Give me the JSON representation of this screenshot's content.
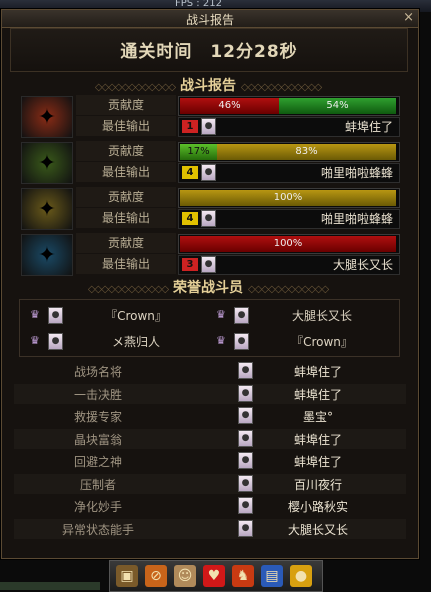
{
  "top_strip": {
    "text": "FPS : 212"
  },
  "window": {
    "title": "战斗报告",
    "close": "×"
  },
  "header": {
    "clear_time": "通关时间　12分28秒"
  },
  "sections": {
    "report": "战斗报告",
    "honor": "荣誉战斗员"
  },
  "labels": {
    "contribution": "贡献度",
    "best_output": "最佳输出"
  },
  "players": [
    {
      "bars": [
        {
          "text": "46%",
          "color": "red",
          "value": 46
        },
        {
          "text": "54%",
          "color": "green",
          "value": 54
        }
      ],
      "badge": "1",
      "badge_color": "#cc2222",
      "name": "蚌埠住了",
      "emblem_color": "#8a2c16"
    },
    {
      "bars": [
        {
          "text": "17%",
          "color": "lime",
          "value": 17
        },
        {
          "text": "83%",
          "color": "gold",
          "value": 83
        }
      ],
      "badge": "4",
      "badge_color": "#e0c000",
      "name": "啪里啪啦蜂蜂",
      "emblem_color": "#3a5a1a"
    },
    {
      "bars": [
        {
          "text": "100%",
          "color": "gold",
          "value": 100
        }
      ],
      "badge": "4",
      "badge_color": "#e0c000",
      "name": "啪里啪啦蜂蜂",
      "emblem_color": "#6a5a1a"
    },
    {
      "bars": [
        {
          "text": "100%",
          "color": "red",
          "value": 100
        }
      ],
      "badge": "3",
      "badge_color": "#cc2222",
      "name": "大腿长又长",
      "emblem_color": "#1a4a66"
    }
  ],
  "honor": [
    {
      "name": "『Crown』"
    },
    {
      "name": "大腿长又长"
    },
    {
      "name": "メ燕归人"
    },
    {
      "name": "『Crown』"
    }
  ],
  "awards": [
    {
      "title": "战场名将",
      "who": "蚌埠住了"
    },
    {
      "title": "一击决胜",
      "who": "蚌埠住了"
    },
    {
      "title": "救援专家",
      "who": "墨宝°"
    },
    {
      "title": "晶块富翁",
      "who": "蚌埠住了"
    },
    {
      "title": "回避之神",
      "who": "蚌埠住了"
    },
    {
      "title": "压制者",
      "who": "百川夜行"
    },
    {
      "title": "净化妙手",
      "who": "樱小路秋实"
    },
    {
      "title": "异常状态能手",
      "who": "大腿长又长"
    }
  ],
  "taskbar": [
    {
      "icon": "bag-icon",
      "glyph": "▣",
      "color": "#7a5a2a"
    },
    {
      "icon": "sword-icon",
      "glyph": "⊘",
      "color": "#c8641a"
    },
    {
      "icon": "character-icon",
      "glyph": "☺",
      "color": "#b08a5a"
    },
    {
      "icon": "heart-icon",
      "glyph": "♥",
      "color": "#d01818"
    },
    {
      "icon": "guild-icon",
      "glyph": "♞",
      "color": "#c83a12"
    },
    {
      "icon": "book-icon",
      "glyph": "▤",
      "color": "#2a5ab8"
    },
    {
      "icon": "coin-icon",
      "glyph": "●",
      "color": "#d8a010"
    }
  ]
}
